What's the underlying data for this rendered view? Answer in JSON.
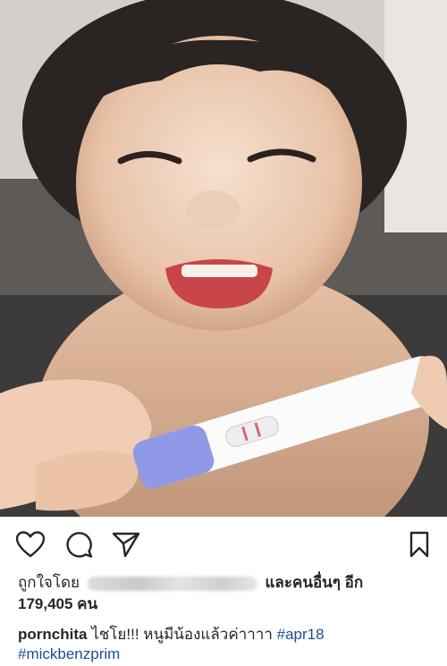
{
  "post": {
    "image": {
      "alt_subject": "photo-toddler-with-pregnancy-test"
    },
    "actions": {
      "like_icon": "heart-icon",
      "comment_icon": "comment-icon",
      "share_icon": "send-icon",
      "save_icon": "bookmark-icon"
    },
    "likes": {
      "prefix": "ถูกใจโดย",
      "and_others": "และคนอื่นๆ",
      "more": "อีก",
      "count": "179,405 คน"
    },
    "caption": {
      "username": "pornchita",
      "text": "ไชโย!!! หนูมีน้องแล้วค่าาาา",
      "hashtag1": "#apr18",
      "hashtag2": "#mickbenzprim"
    }
  }
}
